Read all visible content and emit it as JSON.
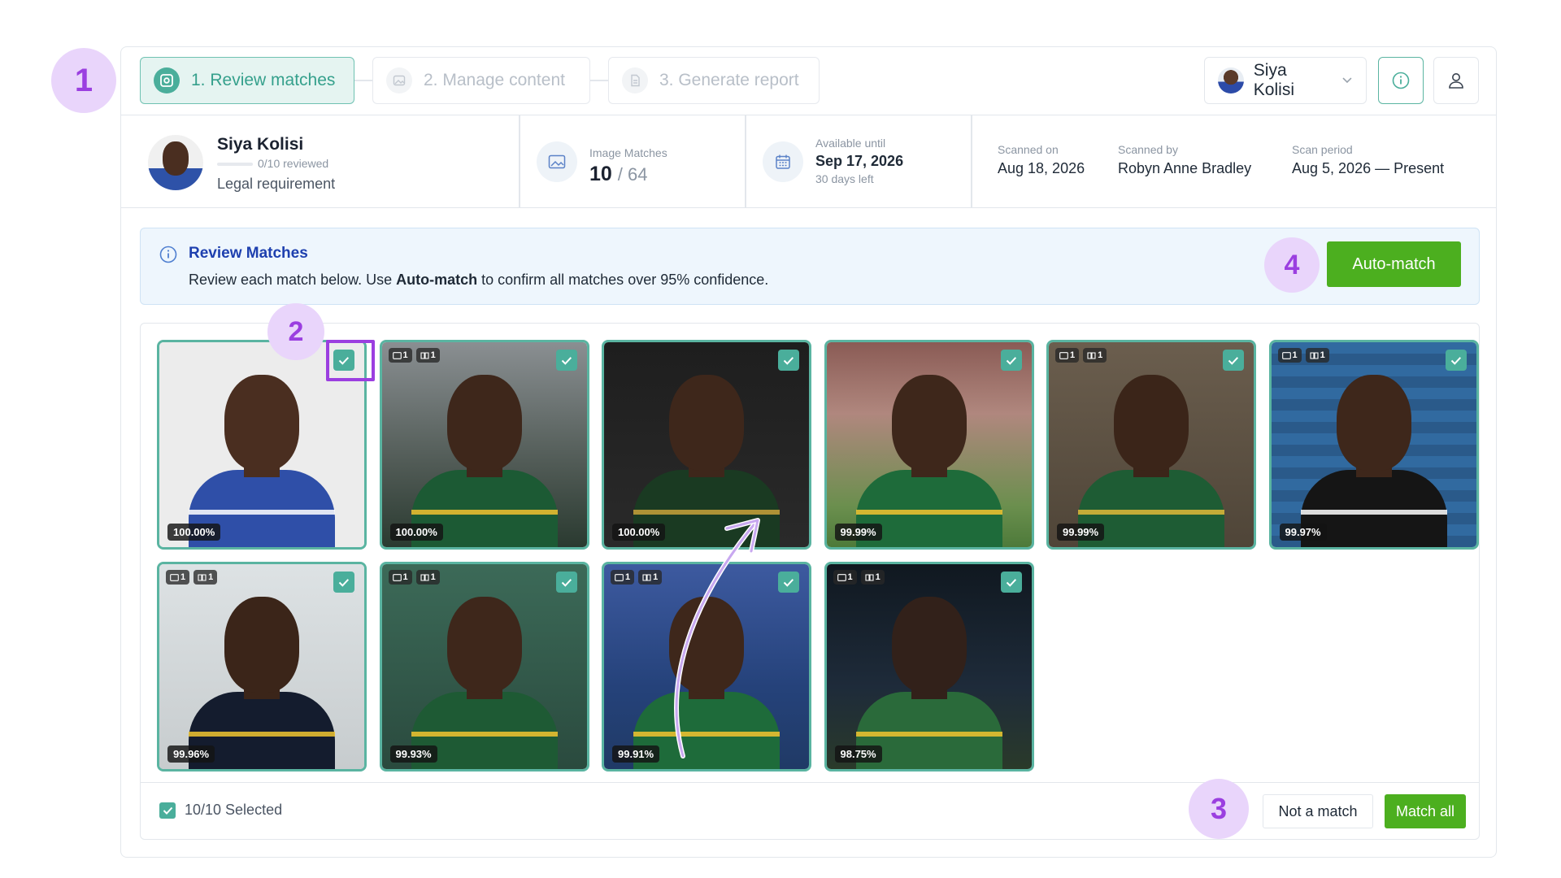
{
  "steps": [
    {
      "label": "1. Review matches",
      "active": true
    },
    {
      "label": "2. Manage content",
      "active": false
    },
    {
      "label": "3. Generate report",
      "active": false
    }
  ],
  "user_menu": {
    "name": "Siya Kolisi"
  },
  "player": {
    "name": "Siya Kolisi",
    "progress_text": "0/10 reviewed",
    "progress": 0,
    "category": "Legal requirement"
  },
  "stats": {
    "image_matches_label": "Image Matches",
    "image_matches": "10",
    "image_total": "/ 64",
    "available_label": "Available until",
    "available_date": "Sep 17, 2026",
    "available_left": "30 days left",
    "scanned_on_label": "Scanned on",
    "scanned_on": "Aug 18, 2026",
    "scanned_by_label": "Scanned by",
    "scanned_by": "Robyn Anne Bradley",
    "scan_period_label": "Scan period",
    "scan_period": "Aug 5, 2026 — Present"
  },
  "notice": {
    "title": "Review Matches",
    "text_before": "Review each match below. Use ",
    "text_bold": "Auto-match",
    "text_after": " to confirm all matches over 95% confidence.",
    "button": "Auto-match"
  },
  "matches": [
    {
      "pct": "100.00%",
      "badges": false,
      "scene": "portrait-white",
      "checked": true
    },
    {
      "pct": "100.00%",
      "badges": true,
      "b1": "1",
      "b2": "1",
      "scene": "green-jersey",
      "checked": true
    },
    {
      "pct": "100.00%",
      "badges": false,
      "scene": "blazer-dark",
      "checked": true
    },
    {
      "pct": "99.99%",
      "badges": false,
      "scene": "stadium",
      "checked": true
    },
    {
      "pct": "99.99%",
      "badges": true,
      "b1": "1",
      "b2": "1",
      "scene": "group",
      "checked": true
    },
    {
      "pct": "99.97%",
      "badges": true,
      "b1": "1",
      "b2": "1",
      "scene": "blue-wall",
      "checked": true
    },
    {
      "pct": "99.96%",
      "badges": true,
      "b1": "1",
      "b2": "1",
      "scene": "navy-jersey",
      "checked": true
    },
    {
      "pct": "99.93%",
      "badges": true,
      "b1": "1",
      "b2": "1",
      "scene": "cap",
      "checked": true
    },
    {
      "pct": "99.91%",
      "badges": true,
      "b1": "1",
      "b2": "1",
      "scene": "headband",
      "checked": true
    },
    {
      "pct": "98.75%",
      "badges": true,
      "b1": "1",
      "b2": "1",
      "scene": "tunnel",
      "checked": true
    }
  ],
  "footer": {
    "selected": "10/10 Selected",
    "not_match": "Not a match",
    "match_all": "Match all"
  },
  "markers": [
    "1",
    "2",
    "3",
    "4"
  ],
  "colors": {
    "accent": "#4aae9b",
    "green": "#4caf1f",
    "marker": "#9b3fe0",
    "marker_bg": "#e9d5fb",
    "notice_title": "#1e40af"
  }
}
